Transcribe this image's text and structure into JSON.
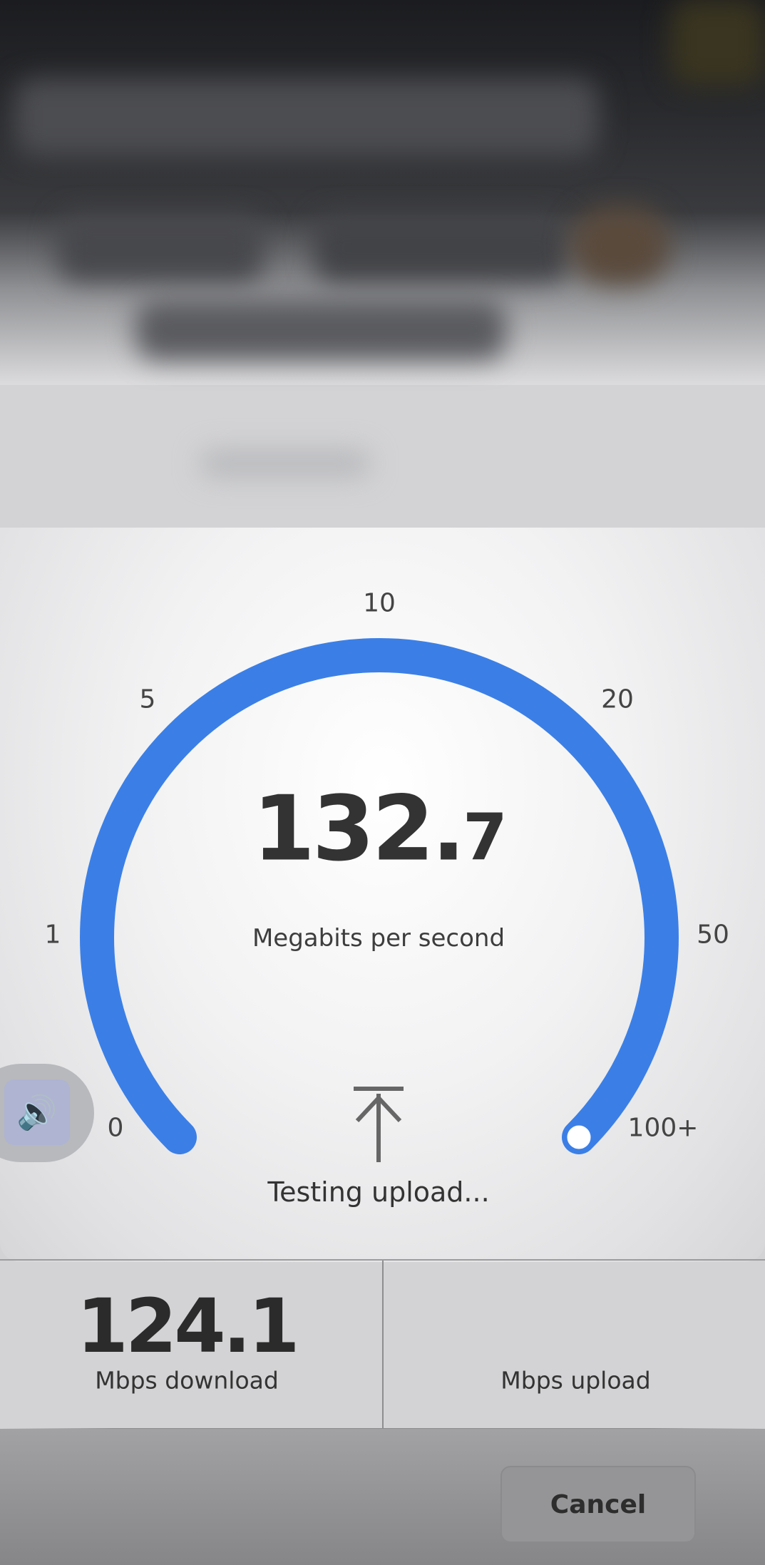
{
  "gauge": {
    "ticks": {
      "t0": "0",
      "t1": "1",
      "t5": "5",
      "t10": "10",
      "t20": "20",
      "t50": "50",
      "t100": "100+"
    },
    "speed_integer": "132.",
    "speed_decimal": "7",
    "unit": "Megabits per second",
    "status": "Testing upload...",
    "accent_color": "#3b7fe6",
    "phase_icon": "upload-arrow-icon"
  },
  "sound_button": {
    "icon": "speaker-icon"
  },
  "results": {
    "download_value": "124.1",
    "download_label": "Mbps download",
    "upload_value": "",
    "upload_label": "Mbps upload"
  },
  "actions": {
    "cancel_label": "Cancel"
  }
}
